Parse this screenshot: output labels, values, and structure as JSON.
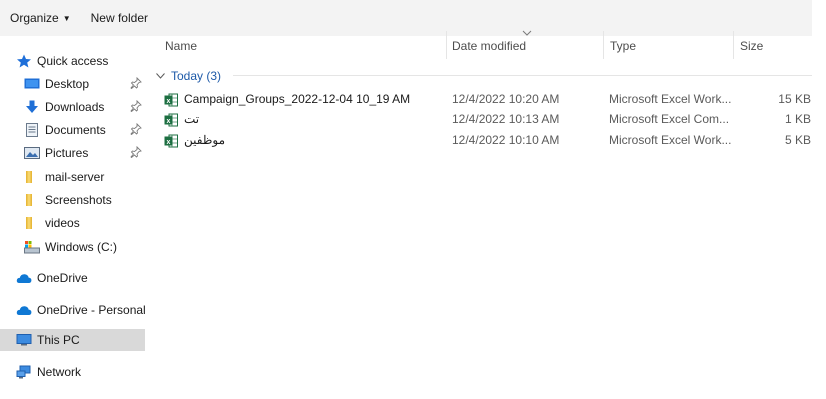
{
  "toolbar": {
    "organize": "Organize",
    "new_folder": "New folder"
  },
  "nav": {
    "items": [
      {
        "label": "Quick access",
        "icon": "star-icon"
      },
      {
        "label": "Desktop",
        "icon": "desktop-icon",
        "pinned": true
      },
      {
        "label": "Downloads",
        "icon": "download-arrow-icon",
        "pinned": true
      },
      {
        "label": "Documents",
        "icon": "document-icon",
        "pinned": true
      },
      {
        "label": "Pictures",
        "icon": "pictures-icon",
        "pinned": true
      },
      {
        "label": "mail-server",
        "icon": "folder-icon"
      },
      {
        "label": "Screenshots",
        "icon": "folder-icon"
      },
      {
        "label": "videos",
        "icon": "folder-icon"
      },
      {
        "label": "Windows (C:)",
        "icon": "drive-icon"
      },
      {
        "label": "OneDrive",
        "icon": "cloud-icon"
      },
      {
        "label": "OneDrive - Personal",
        "icon": "cloud-icon"
      },
      {
        "label": "This PC",
        "icon": "computer-icon",
        "selected": true
      },
      {
        "label": "Network",
        "icon": "network-icon"
      }
    ]
  },
  "columns": {
    "name": "Name",
    "date": "Date modified",
    "type": "Type",
    "size": "Size"
  },
  "group": {
    "label": "Today (3)"
  },
  "files": [
    {
      "name": "Campaign_Groups_2022-12-04 10_19 AM",
      "date": "12/4/2022 10:20 AM",
      "type": "Microsoft Excel Work...",
      "size": "15 KB"
    },
    {
      "name": "تت",
      "date": "12/4/2022 10:13 AM",
      "type": "Microsoft Excel Com...",
      "size": "1 KB"
    },
    {
      "name": "موظفين",
      "date": "12/4/2022 10:10 AM",
      "type": "Microsoft Excel Work...",
      "size": "5 KB"
    }
  ],
  "colors": {
    "accent": "#1e5aa8",
    "selected": "#d9d9d9",
    "excel": "#1d6f42",
    "onedrive": "#0f78d4"
  }
}
